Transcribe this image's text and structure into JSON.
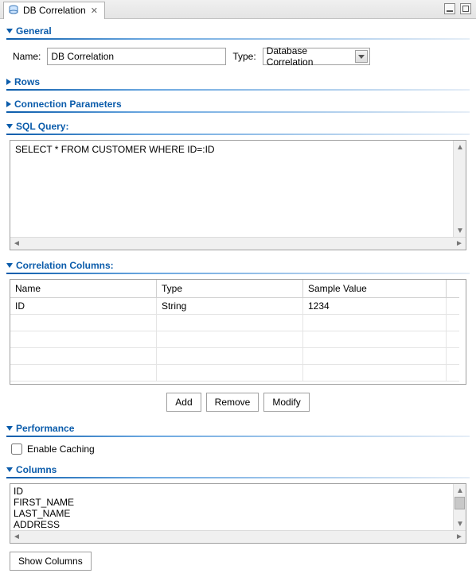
{
  "tab": {
    "title": "DB Correlation"
  },
  "sections": {
    "general": "General",
    "rows": "Rows",
    "connection": "Connection Parameters",
    "sql": "SQL Query:",
    "correlation": "Correlation Columns:",
    "performance": "Performance",
    "columns": "Columns"
  },
  "general_form": {
    "name_label": "Name:",
    "name_value": "DB Correlation",
    "type_label": "Type:",
    "type_value": "Database Correlation"
  },
  "sql_query": "SELECT * FROM CUSTOMER WHERE ID=:ID",
  "correlation_table": {
    "headers": {
      "name": "Name",
      "type": "Type",
      "sample": "Sample Value"
    },
    "rows": [
      {
        "name": "ID",
        "type": "String",
        "sample": "1234"
      }
    ]
  },
  "buttons": {
    "add": "Add",
    "remove": "Remove",
    "modify": "Modify",
    "show_columns": "Show Columns"
  },
  "performance": {
    "enable_caching_label": "Enable Caching",
    "enable_caching_checked": false
  },
  "columns_list": [
    "ID",
    "FIRST_NAME",
    "LAST_NAME",
    "ADDRESS"
  ]
}
